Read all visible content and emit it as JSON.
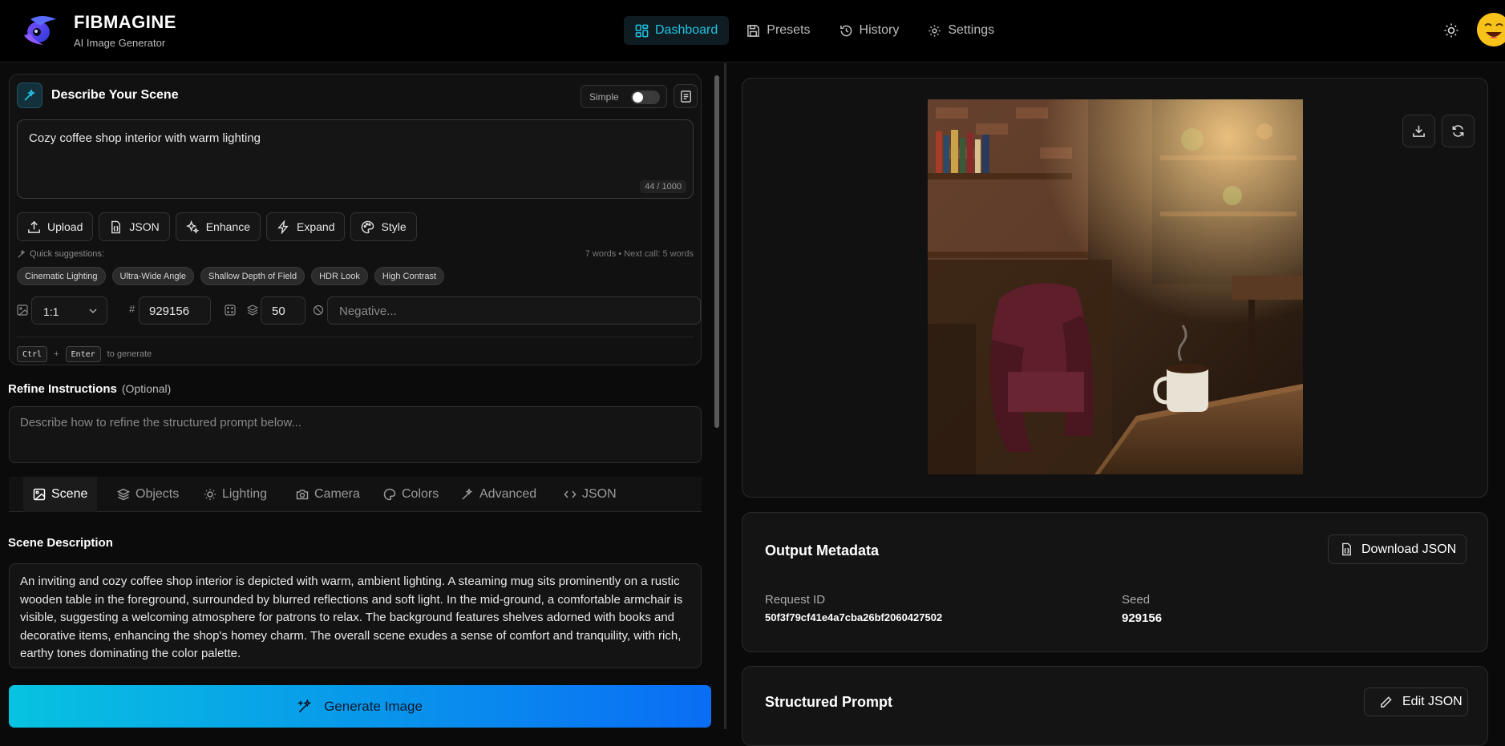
{
  "brand": {
    "name": "FIBMAGINE",
    "subtitle": "AI Image Generator"
  },
  "nav": [
    {
      "label": "Dashboard",
      "icon": "dashboard-icon",
      "active": true
    },
    {
      "label": "Presets",
      "icon": "save-icon"
    },
    {
      "label": "History",
      "icon": "history-icon"
    },
    {
      "label": "Settings",
      "icon": "gear-icon"
    }
  ],
  "scene": {
    "title": "Describe Your Scene",
    "mode_label": "Simple",
    "prompt": "Cozy coffee shop interior with warm lighting",
    "char_count": "44 / 1000",
    "tools": [
      "Upload",
      "JSON",
      "Enhance",
      "Expand",
      "Style"
    ],
    "quick_label": "Quick suggestions:",
    "quick_meta": "7 words  • Next call: 5 words",
    "suggestions": [
      "Cinematic Lighting",
      "Ultra-Wide Angle",
      "Shallow Depth of Field",
      "HDR Look",
      "High Contrast"
    ],
    "ratio": "1:1",
    "seed": "929156",
    "steps": "50",
    "negative_placeholder": "Negative...",
    "kbd_ctrl": "Ctrl",
    "kbd_plus": "+",
    "kbd_enter": "Enter",
    "kbd_hint": "to generate"
  },
  "refine": {
    "title": "Refine Instructions",
    "optional": "(Optional)",
    "placeholder": "Describe how to refine the structured prompt below..."
  },
  "tabs": [
    "Scene",
    "Objects",
    "Lighting",
    "Camera",
    "Colors",
    "Advanced",
    "JSON"
  ],
  "scene_description": {
    "title": "Scene Description",
    "text": "An inviting and cozy coffee shop interior is depicted with warm, ambient lighting. A steaming mug sits prominently on a rustic wooden table in the foreground, surrounded by blurred reflections and soft light. In the mid-ground, a comfortable armchair is visible, suggesting a welcoming atmosphere for patrons to relax. The background features shelves adorned with books and decorative items, enhancing the shop's homey charm. The overall scene exudes a sense of comfort and tranquility, with rich, earthy tones dominating the color palette."
  },
  "generate_label": "Generate Image",
  "metadata": {
    "title": "Output Metadata",
    "download_label": "Download JSON",
    "request_id_label": "Request ID",
    "request_id": "50f3f79cf41e4a7cba26bf2060427502",
    "seed_label": "Seed",
    "seed": "929156"
  },
  "structured": {
    "title": "Structured Prompt",
    "edit_label": "Edit JSON"
  },
  "colors": {
    "accent": "#22c3e6",
    "gradient_start": "#07c3e0",
    "gradient_end": "#0a6df5"
  }
}
